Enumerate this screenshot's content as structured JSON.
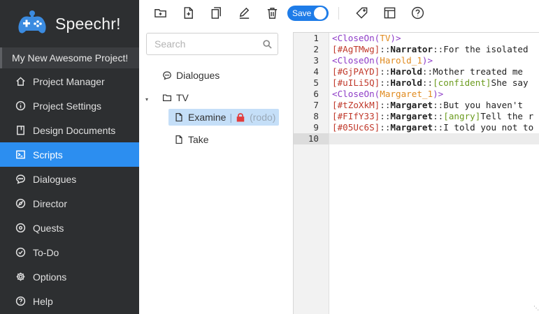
{
  "app": {
    "name": "Speechr!"
  },
  "project": {
    "title": "My New Awesome Project!"
  },
  "nav": [
    {
      "label": "Project Manager",
      "icon": "home-icon"
    },
    {
      "label": "Project Settings",
      "icon": "info-icon"
    },
    {
      "label": "Design Documents",
      "icon": "document-icon"
    },
    {
      "label": "Scripts",
      "icon": "terminal-icon",
      "active": true
    },
    {
      "label": "Dialogues",
      "icon": "chat-icon"
    },
    {
      "label": "Director",
      "icon": "compass-icon"
    },
    {
      "label": "Quests",
      "icon": "target-icon"
    },
    {
      "label": "To-Do",
      "icon": "check-circle-icon"
    },
    {
      "label": "Options",
      "icon": "gear-icon"
    },
    {
      "label": "Help",
      "icon": "question-icon"
    }
  ],
  "toolbar": {
    "save_label": "Save"
  },
  "search": {
    "placeholder": "Search"
  },
  "tree": {
    "dialogues": "Dialogues",
    "folder": "TV",
    "selected_file": "Examine",
    "lock_separator": "|",
    "lock_user": "(rodo)",
    "file2": "Take"
  },
  "editor": {
    "line_numbers": [
      "1",
      "2",
      "3",
      "4",
      "5",
      "6",
      "7",
      "8",
      "9",
      "10"
    ],
    "lines": [
      {
        "parts": [
          [
            "tag",
            "<CloseOn("
          ],
          [
            "arg",
            "TV"
          ],
          [
            "tag",
            ")>"
          ]
        ]
      },
      {
        "parts": [
          [
            "id",
            "[#AgTMwg]"
          ],
          [
            "sep",
            "::"
          ],
          [
            "name",
            "Narrator"
          ],
          [
            "sep",
            "::"
          ],
          [
            "text",
            "For the isolated"
          ]
        ]
      },
      {
        "parts": [
          [
            "tag",
            "<CloseOn("
          ],
          [
            "arg",
            "Harold_1"
          ],
          [
            "tag",
            ")>"
          ]
        ]
      },
      {
        "parts": [
          [
            "id",
            "[#GjPAYD]"
          ],
          [
            "sep",
            "::"
          ],
          [
            "name",
            "Harold"
          ],
          [
            "sep",
            "::"
          ],
          [
            "text",
            "Mother treated me"
          ]
        ]
      },
      {
        "parts": [
          [
            "id",
            "[#uILi5Q]"
          ],
          [
            "sep",
            "::"
          ],
          [
            "name",
            "Harold"
          ],
          [
            "sep",
            "::"
          ],
          [
            "emo",
            "[confident]"
          ],
          [
            "text",
            "She say"
          ]
        ]
      },
      {
        "parts": [
          [
            "tag",
            "<CloseOn("
          ],
          [
            "arg",
            "Margaret_1"
          ],
          [
            "tag",
            ")>"
          ]
        ]
      },
      {
        "parts": [
          [
            "id",
            "[#tZoXkM]"
          ],
          [
            "sep",
            "::"
          ],
          [
            "name",
            "Margaret"
          ],
          [
            "sep",
            "::"
          ],
          [
            "text",
            "But you haven't"
          ]
        ]
      },
      {
        "parts": [
          [
            "id",
            "[#FIfY33]"
          ],
          [
            "sep",
            "::"
          ],
          [
            "name",
            "Margaret"
          ],
          [
            "sep",
            "::"
          ],
          [
            "emo",
            "[angry]"
          ],
          [
            "text",
            "Tell the r"
          ]
        ]
      },
      {
        "parts": [
          [
            "id",
            "[#05Uc6S]"
          ],
          [
            "sep",
            "::"
          ],
          [
            "name",
            "Margaret"
          ],
          [
            "sep",
            "::"
          ],
          [
            "text",
            "I told you not to"
          ]
        ]
      },
      {
        "parts": []
      }
    ]
  },
  "colors": {
    "accent": "#2c8ef0",
    "sidebar": "#2d2f31",
    "toggle": "#1e7ce8"
  }
}
